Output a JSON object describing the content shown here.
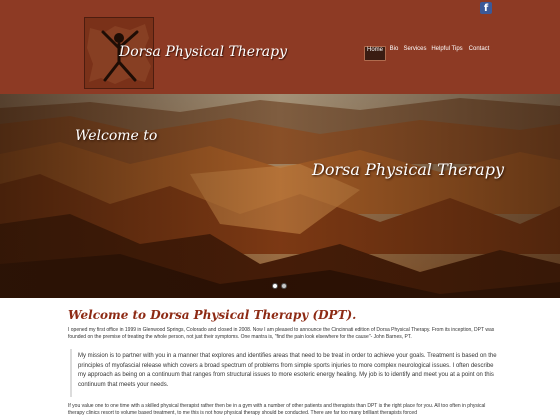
{
  "header": {
    "site_name": "Dorsa Physical Therapy",
    "social_icon": "facebook-icon",
    "facebook_glyph": "f",
    "colors": {
      "header_bg": "#8d3a24",
      "nav_active_bg": "#3a1c12",
      "heading": "#8d2a14"
    }
  },
  "nav": {
    "items": [
      {
        "label": "Home",
        "active": true
      },
      {
        "label": "Bio"
      },
      {
        "label": "Services"
      },
      {
        "label": "Helpful Tips"
      },
      {
        "label": "Contact"
      }
    ]
  },
  "hero": {
    "welcome_text": "Welcome to",
    "title": "Dorsa Physical Therapy",
    "slide_count": 2,
    "active_slide": 1
  },
  "content": {
    "heading": "Welcome to Dorsa Physical Therapy (DPT).",
    "intro": "I opened my first office in 1999 in Glenwood Springs, Colorado and closed in 2008. Now I am pleased to announce the Cincinnati edition of Dorsa Physical Therapy. From its inception, DPT was founded on the premise of treating the whole person, not just their symptoms. One mantra is, \"find the pain look elsewhere for the cause\"- John Barnes, PT.",
    "quote": "My mission is to partner with you in a manner that explores and identifies areas that need to be treat in order to achieve your goals. Treatment is based on the principles of myofascial release which covers a broad spectrum of problems from simple sports injuries to more complex neurological issues. I often describe my approach as being on a continuum that ranges from structural issues to more esoteric energy healing. My job is to identify and meet you at a point on this continuum that meets your needs.",
    "closing": "If you value one to one time with a skilled physical therapist rather then be in a gym with a number of other patients and therapists than DPT is the right place for you. All too often in physical therapy clinics resort to volume based treatment, to me this is not how physical therapy should be conducted. There are far too many brilliant therapists forced"
  }
}
